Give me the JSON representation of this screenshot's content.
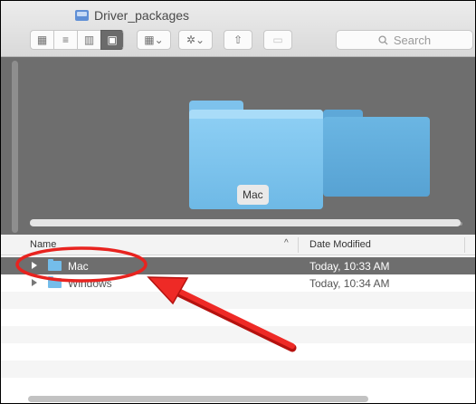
{
  "window": {
    "title": "Driver_packages"
  },
  "toolbar": {
    "view_buttons": [
      {
        "icon": "icon-view-icon",
        "glyph": "▦"
      },
      {
        "icon": "list-view-icon",
        "glyph": "≡"
      },
      {
        "icon": "column-view-icon",
        "glyph": "▥"
      },
      {
        "icon": "cover-flow-view-icon",
        "glyph": "▣"
      }
    ],
    "arrange_glyph": "▦⌄",
    "action_glyph": "✲⌄",
    "share_glyph": "⇧",
    "tag_glyph": "▭"
  },
  "search": {
    "placeholder": "Search",
    "icon": "search-icon"
  },
  "coverflow": {
    "selected_label": "Mac"
  },
  "list": {
    "columns": {
      "name": "Name",
      "date_modified": "Date Modified",
      "sort_indicator": "^"
    },
    "rows": [
      {
        "name": "Mac",
        "date": "Today, 10:33 AM",
        "selected": true
      },
      {
        "name": "Windows",
        "date": "Today, 10:34 AM",
        "selected": false
      }
    ]
  },
  "colors": {
    "annotation_red": "#e8231f",
    "folder_blue": "#74bdea",
    "selection_gray": "#6e6e6e"
  }
}
